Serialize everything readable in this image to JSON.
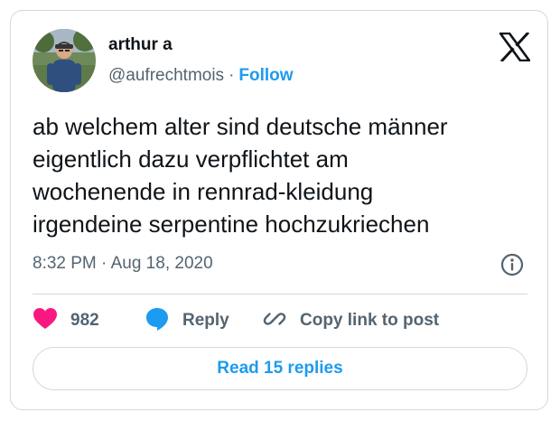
{
  "author": {
    "name": "arthur a",
    "handle": "@aufrechtmois",
    "separator": "·",
    "follow_label": "Follow"
  },
  "tweet": {
    "text": "ab welchem alter sind deutsche männer\neigentlich dazu verpflichtet am\nwochenende in rennrad-kleidung\nirgendeine serpentine hochzukriechen",
    "timestamp": "8:32 PM · Aug 18, 2020"
  },
  "actions": {
    "like_count": "982",
    "reply_label": "Reply",
    "copy_link_label": "Copy link to post"
  },
  "read_replies_label": "Read 15 replies",
  "icons": {
    "brand": "x-logo-icon",
    "like": "heart-icon",
    "reply": "speech-bubble-icon",
    "copy": "link-icon",
    "info": "info-icon"
  },
  "colors": {
    "accent": "#1d9bf0",
    "like": "#f91880",
    "text": "#0f1419",
    "secondary": "#536471",
    "border": "#cfd9de"
  }
}
